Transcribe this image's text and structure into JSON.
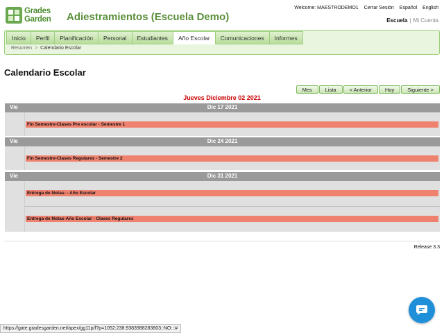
{
  "brand": {
    "line1": "Grades",
    "line2": "Garden",
    "color": "#6aa84f"
  },
  "app_title": "Adiestramientos (Escuela Demo)",
  "top_links": {
    "welcome": "Welcome: MAESTRODEMO1",
    "logout": "Cerrar Sesión",
    "spanish": "Español",
    "english": "English"
  },
  "school_links": {
    "school": "Escuela",
    "separator": "|",
    "my_account": "Mi Cuenta"
  },
  "tabs": [
    {
      "label": "Inicio"
    },
    {
      "label": "Perfil"
    },
    {
      "label": "Planificación"
    },
    {
      "label": "Personal"
    },
    {
      "label": "Estudiantes"
    },
    {
      "label": "Año Escolar"
    },
    {
      "label": "Comunicaciones"
    },
    {
      "label": "Informes"
    }
  ],
  "active_tab": "Año Escolar",
  "breadcrumb": {
    "home": "Resumen",
    "separator": ">",
    "current": "Calendario Escolar"
  },
  "page_title": "Calendario Escolar",
  "calendar_nav": {
    "month": "Mes",
    "list": "Lista",
    "previous": "< Anterior",
    "today": "Hoy",
    "next": "Siguiente >"
  },
  "current_date": "Jueves Diciembre 02 2021",
  "days": [
    {
      "dow": "Vie",
      "date": "Dic 17 2021",
      "events": [
        "Fin Semestre-Clases Pre escolar - Semestre 1"
      ]
    },
    {
      "dow": "Vie",
      "date": "Dic 24 2021",
      "events": [
        "Fin Semestre-Clases Regulares - Semestre 2"
      ]
    },
    {
      "dow": "Vie",
      "date": "Dic 31 2021",
      "events": [
        "Entrega de Notas- - Año Escolar",
        "Entrega de Notas-Año Escolar - Clases Regulares"
      ]
    }
  ],
  "release": "Release 3.3",
  "status_url": "https://gate.gradesgarden.net/apex/gg11p/f?p=1052:238:9383988283803::NO:::#",
  "colors": {
    "event": "#ef826f",
    "day_header": "#9a9a9a",
    "current_date": "#cc0000",
    "chat": "#1f8fd9"
  }
}
